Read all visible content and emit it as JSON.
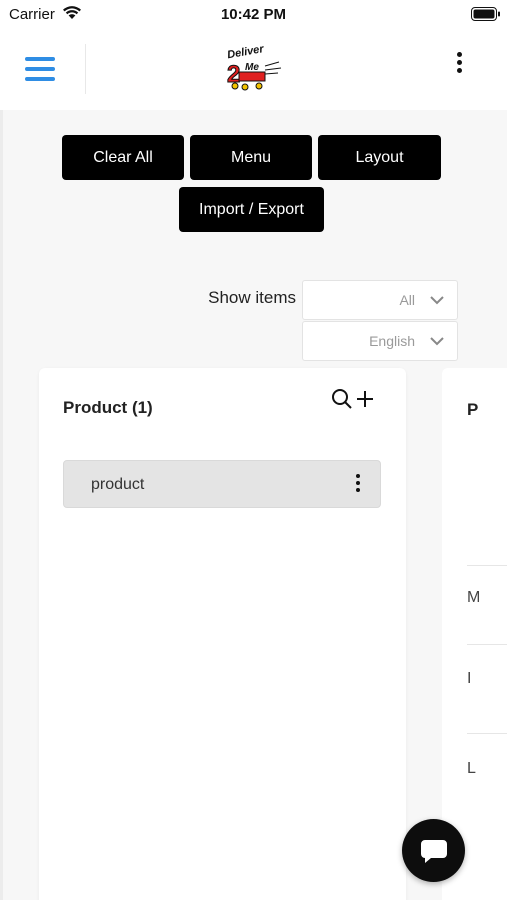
{
  "status_bar": {
    "carrier": "Carrier",
    "time": "10:42 PM"
  },
  "header": {
    "logo_text_top": "Deliver",
    "logo_text_num": "2",
    "logo_text_bottom": "Me"
  },
  "toolbar": {
    "clear_all": "Clear All",
    "menu": "Menu",
    "layout": "Layout",
    "import_export": "Import / Export"
  },
  "filters": {
    "show_items_label": "Show items",
    "show_items_value": "All",
    "language_value": "English"
  },
  "product_card": {
    "title": "Product (1)",
    "items": [
      {
        "label": "product"
      }
    ]
  },
  "next_card": {
    "title_fragment": "P",
    "rows": [
      "M",
      "I",
      "L"
    ]
  },
  "colors": {
    "accent": "#2f8de4",
    "button_bg": "#000000",
    "item_bg": "#e4e4e4"
  }
}
